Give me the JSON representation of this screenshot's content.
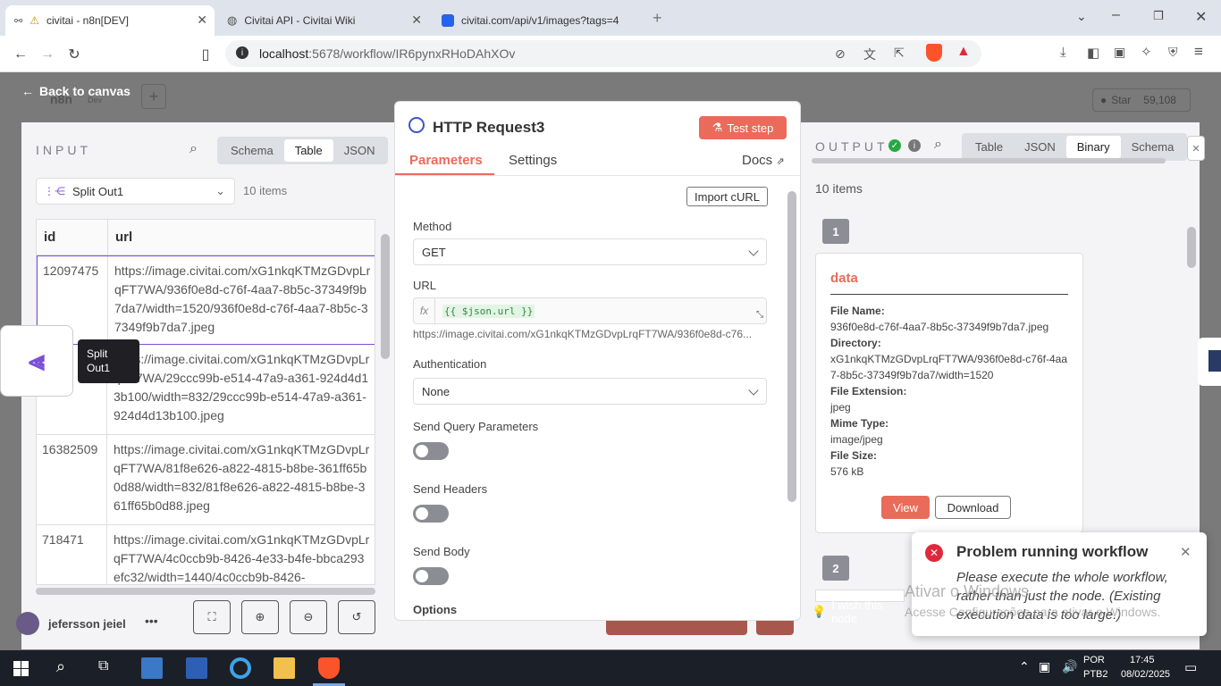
{
  "browser": {
    "tabs": [
      {
        "title": "civitai - n8n[DEV]",
        "active": true
      },
      {
        "title": "Civitai API - Civitai Wiki",
        "active": false
      },
      {
        "title": "civitai.com/api/v1/images?tags=4",
        "active": false
      }
    ],
    "url_host": "localhost",
    "url_rest": ":5678/workflow/IR6pynxRHoDAhXOv"
  },
  "canvas": {
    "back_label": "Back to canvas",
    "logo_text": "n8n",
    "dev_badge": "Dev",
    "github_star": "Star",
    "github_count": "59,108",
    "user_name": "jefersson jeiel",
    "wish_text": "I wish this node",
    "tooltip": "Split Out1",
    "watermark_line1": "Ativar o Windows",
    "watermark_line2": "Acesse Configurações para ativar o Windows."
  },
  "input": {
    "title": "INPUT",
    "tabs": [
      "Schema",
      "Table",
      "JSON"
    ],
    "active_tab": "Table",
    "source_node": "Split Out1",
    "count": "10 items",
    "columns": [
      "id",
      "url"
    ],
    "rows": [
      {
        "id": "12097475",
        "url": "https://image.civitai.com/xG1nkqKTMzGDvpLrqFT7WA/936f0e8d-c76f-4aa7-8b5c-37349f9b7da7/width=1520/936f0e8d-c76f-4aa7-8b5c-37349f9b7da7.jpeg"
      },
      {
        "id": "",
        "url": "https://image.civitai.com/xG1nkqKTMzGDvpLrqFT7WA/29ccc99b-e514-47a9-a361-924d4d13b100/width=832/29ccc99b-e514-47a9-a361-924d4d13b100.jpeg"
      },
      {
        "id": "16382509",
        "url": "https://image.civitai.com/xG1nkqKTMzGDvpLrqFT7WA/81f8e626-a822-4815-b8be-361ff65b0d88/width=832/81f8e626-a822-4815-b8be-361ff65b0d88.jpeg"
      },
      {
        "id": "718471",
        "url": "https://image.civitai.com/xG1nkqKTMzGDvpLrqFT7WA/4c0ccb9b-8426-4e33-b4fe-bbca293efc32/width=1440/4c0ccb9b-8426-"
      }
    ]
  },
  "node": {
    "title": "HTTP Request3",
    "test_step": "Test step",
    "tabs": [
      "Parameters",
      "Settings"
    ],
    "docs": "Docs",
    "import_curl": "Import cURL",
    "method_label": "Method",
    "method_value": "GET",
    "url_label": "URL",
    "url_fx": "fx",
    "url_expression": "{{ $json.url }}",
    "url_preview": "https://image.civitai.com/xG1nkqKTMzGDvpLrqFT7WA/936f0e8d-c76...",
    "auth_label": "Authentication",
    "auth_value": "None",
    "send_query": "Send Query Parameters",
    "send_headers": "Send Headers",
    "send_body": "Send Body",
    "options": "Options"
  },
  "output": {
    "title": "OUTPUT",
    "tabs": [
      "Table",
      "JSON",
      "Binary",
      "Schema"
    ],
    "active_tab": "Binary",
    "count": "10 items",
    "item1": "1",
    "item2": "2",
    "card_title": "data",
    "file_name_label": "File Name:",
    "file_name": "936f0e8d-c76f-4aa7-8b5c-37349f9b7da7.jpeg",
    "directory_label": "Directory:",
    "directory": "xG1nkqKTMzGDvpLrqFT7WA/936f0e8d-c76f-4aa7-8b5c-37349f9b7da7/width=1520",
    "extension_label": "File Extension:",
    "extension": "jpeg",
    "mime_label": "Mime Type:",
    "mime": "image/jpeg",
    "size_label": "File Size:",
    "size": "576 kB",
    "view": "View",
    "download": "Download"
  },
  "toast": {
    "title": "Problem running workflow",
    "message": "Please execute the whole workflow, rather than just the node. (Existing execution data is too large.)"
  },
  "taskbar": {
    "lang1": "POR",
    "lang2": "PTB2",
    "time": "17:45",
    "date": "08/02/2025"
  },
  "colors": {
    "accent": "#ea6b5a",
    "link": "#ff6d5a",
    "success": "#28a745",
    "error": "#e0283c"
  }
}
